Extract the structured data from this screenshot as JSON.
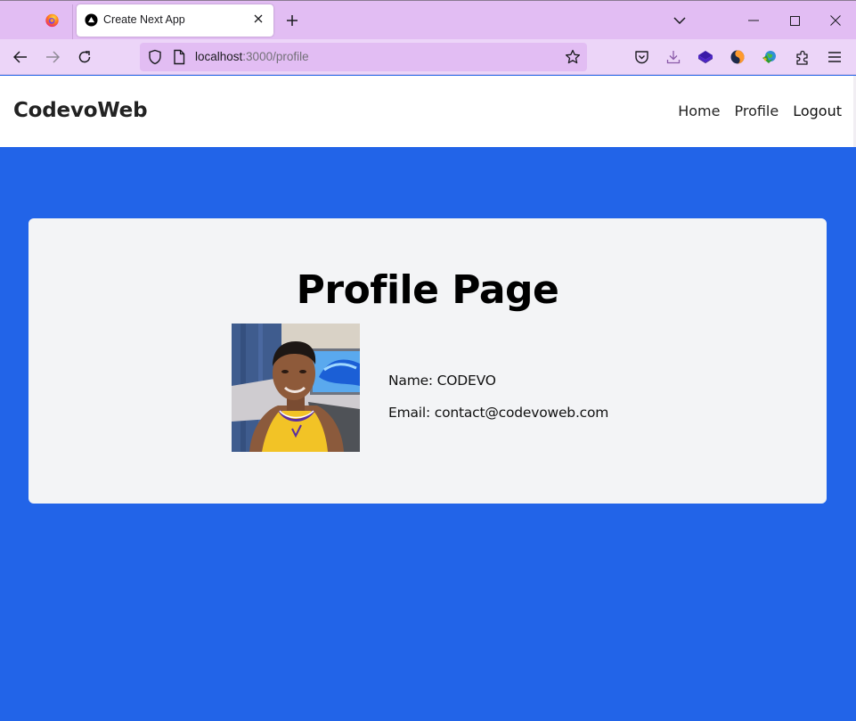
{
  "browser": {
    "tab": {
      "title": "Create Next App",
      "favicon": "nextjs-icon"
    },
    "url": {
      "host": "localhost",
      "rest": ":3000/profile"
    },
    "toolbar_icons": [
      "pocket-icon",
      "download-icon",
      "extension-stack-icon",
      "extension-s-icon",
      "extension-globe-icon",
      "extensions-puzzle-icon",
      "menu-icon"
    ]
  },
  "site": {
    "brand": "CodevoWeb",
    "nav": [
      {
        "label": "Home"
      },
      {
        "label": "Profile"
      },
      {
        "label": "Logout"
      }
    ]
  },
  "profile": {
    "title": "Profile Page",
    "name_line": "Name: CODEVO",
    "email_line": "Email: contact@codevoweb.com",
    "avatar_alt": "profile photo"
  },
  "colors": {
    "page_background": "#2264e8",
    "card_background": "#f3f4f6",
    "header_background": "#ffffff",
    "browser_chrome": "#e2bdf3"
  }
}
